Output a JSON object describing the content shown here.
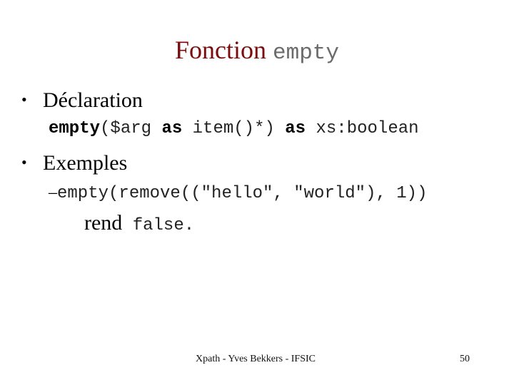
{
  "slide": {
    "title": {
      "text": "Fonction",
      "code": "empty"
    },
    "bullets": [
      {
        "label": "Déclaration",
        "signature": {
          "fn": "empty",
          "open": "($arg ",
          "kw1": "as",
          "mid": " item()*) ",
          "kw2": "as",
          "ret": " xs:boolean"
        }
      },
      {
        "label": "Exemples",
        "example": {
          "dash": "–",
          "code": "empty(remove((\"hello\", \"world\"), 1))",
          "result_word": "rend",
          "result_value": "false."
        }
      }
    ],
    "bullet_char": "•",
    "footer": {
      "text": "Xpath - Yves Bekkers - IFSIC",
      "page_number": "50"
    }
  }
}
